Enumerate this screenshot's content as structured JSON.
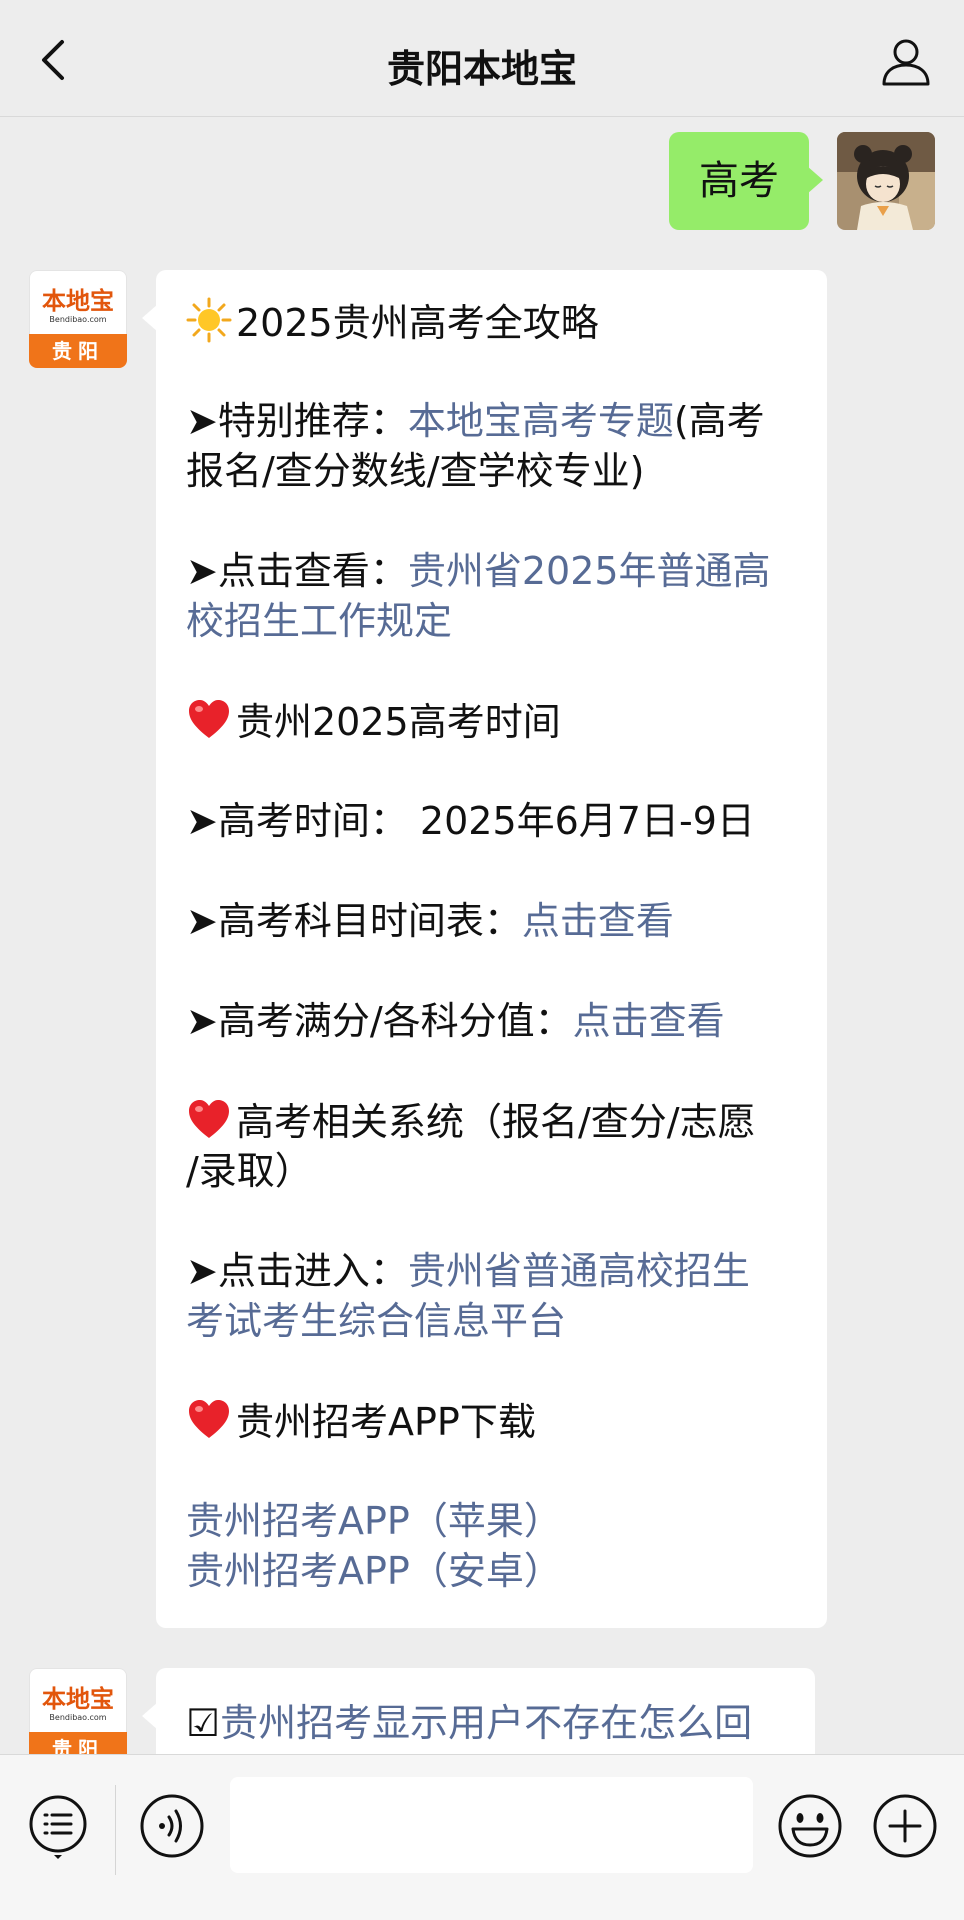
{
  "header": {
    "title": "贵阳本地宝"
  },
  "outgoing": {
    "text": "高考"
  },
  "bot_avatar": {
    "logo": "本地宝",
    "url": "Bendibao.com",
    "city": "贵阳"
  },
  "message1": {
    "title": "2025贵州高考全攻略",
    "rec_prefix": "➤特别推荐：",
    "rec_link": "本地宝高考专题",
    "rec_suffix": "(高考",
    "rec_line2": "报名/查分数线/查学校专业)",
    "view_prefix": "➤点击查看：",
    "view_link_line1": "贵州省2025年普通高",
    "view_link_line2": "校招生工作规定",
    "section_time": "贵州2025高考时间",
    "exam_time": "➤高考时间：  2025年6月7日-9日",
    "schedule_prefix": "➤高考科目时间表：",
    "schedule_link": "点击查看",
    "score_prefix": "➤高考满分/各科分值：",
    "score_link": "点击查看",
    "section_system_line1": "高考相关系统（报名/查分/志愿",
    "section_system_line2": "/录取）",
    "enter_prefix": "➤点击进入：",
    "enter_link_line1": "贵州省普通高校招生",
    "enter_link_line2": "考试考生综合信息平台",
    "section_app": "贵州招考APP下载",
    "app_ios": "贵州招考APP（苹果）",
    "app_android": "贵州招考APP（安卓）"
  },
  "message2": {
    "checkbox": "☑",
    "text": "贵州招考显示用户不存在怎么回"
  },
  "icons": {
    "back": "chevron-left-icon",
    "profile": "person-icon",
    "menu": "list-icon",
    "voice": "voice-icon",
    "emoji": "smiley-icon",
    "plus": "plus-icon",
    "sun": "sun-emoji",
    "heart": "heart-emoji"
  },
  "colors": {
    "background": "#ededed",
    "outgoing_bubble": "#95ec69",
    "incoming_bubble": "#ffffff",
    "link": "#576b95",
    "brand_orange": "#f07419"
  }
}
